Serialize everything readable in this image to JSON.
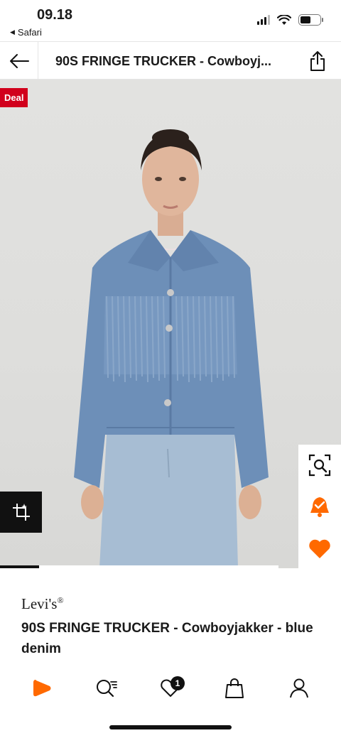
{
  "status_bar": {
    "time": "09.18",
    "back_app": "Safari",
    "battery_level": 0.55
  },
  "header": {
    "title": "90S FRINGE TRUCKER - Cowboyj..."
  },
  "image": {
    "deal_label": "Deal",
    "gallery_progress": 0.14
  },
  "product": {
    "brand": "Levi's",
    "brand_mark": "®",
    "name": "90S FRINGE TRUCKER - Cowboyjakker - blue denim"
  },
  "bottom_nav": {
    "wishlist_count": "1"
  },
  "colors": {
    "accent": "#ff6900",
    "deal": "#d1001c"
  },
  "icons": [
    "back-arrow-icon",
    "share-icon",
    "visual-search-icon",
    "price-alert-icon",
    "heart-icon",
    "crop-icon",
    "home-icon",
    "search-icon",
    "wishlist-icon",
    "bag-icon",
    "profile-icon"
  ]
}
